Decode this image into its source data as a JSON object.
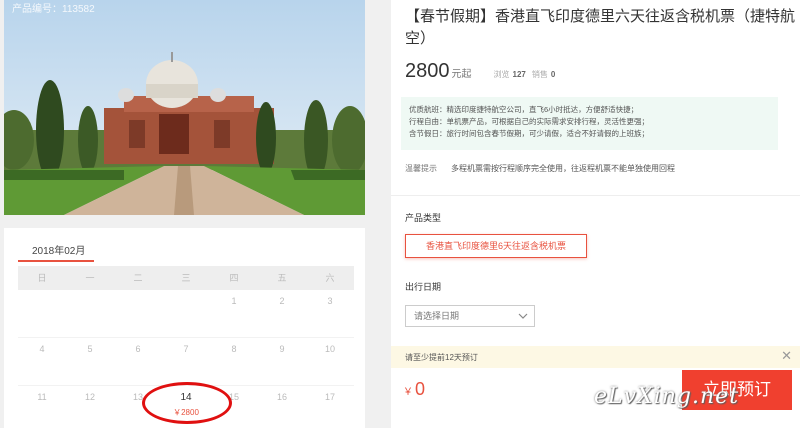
{
  "photo": {
    "caption": "产品编号：113582"
  },
  "calendar": {
    "month": "2018年02月",
    "weekdays": [
      "日",
      "一",
      "二",
      "三",
      "四",
      "五",
      "六"
    ],
    "rows": [
      [
        "",
        "",
        "",
        "",
        "1",
        "2",
        "3"
      ],
      [
        "4",
        "5",
        "6",
        "7",
        "8",
        "9",
        "10"
      ],
      [
        "11",
        "12",
        "13",
        "14",
        "15",
        "16",
        "17"
      ]
    ],
    "selected": {
      "day": "14",
      "price": "￥2800"
    }
  },
  "product": {
    "title": "【春节假期】香港直飞印度德里六天往返含税机票（捷特航空）",
    "price": "2800",
    "price_unit": "元起",
    "views_label": "浏览",
    "views": "127",
    "sales_label": "销售",
    "sales": "0"
  },
  "features": [
    "优质航班：精选印度捷特航空公司，直飞6小时抵达，方便舒适快捷；",
    "行程自由：单机票产品，可根据自己的实际需求安排行程，灵活性更强；",
    "含节假日：旅行时间包含春节假期，可少请假，适合不好请假的上班族；"
  ],
  "notice": {
    "label": "温馨提示",
    "text": "多程机票需按行程顺序完全使用，往返程机票不能单独使用回程"
  },
  "product_type": {
    "label": "产品类型",
    "option": "香港直飞印度德里6天往返含税机票"
  },
  "departure": {
    "label": "出行日期",
    "placeholder": "请选择日期"
  },
  "tip": {
    "text": "请至少提前12天预订"
  },
  "total": {
    "currency": "￥",
    "amount": "0"
  },
  "book_button": "立即预订",
  "watermark": "eLvXing.net",
  "colors": {
    "accent": "#e8523f",
    "book": "#f0402f",
    "feature_bg": "#eff9f4",
    "tip_bg": "#fdf8e4"
  }
}
